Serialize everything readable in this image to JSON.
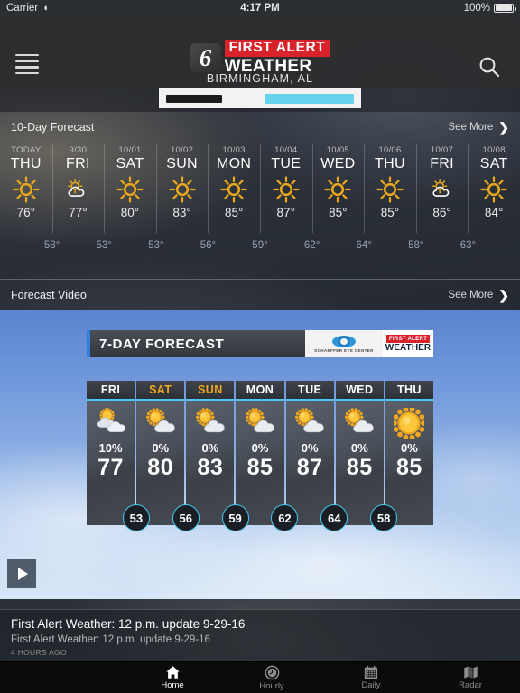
{
  "status_bar": {
    "carrier": "Carrier",
    "wifi_icon": "wifi-icon",
    "time": "4:17 PM",
    "battery_percent": "100%"
  },
  "header": {
    "menu_icon": "hamburger-menu-icon",
    "search_icon": "search-icon",
    "logo_number": "6",
    "logo_line1": "FIRST ALERT",
    "logo_line2": "WEATHER",
    "city": "BIRMINGHAM, AL"
  },
  "ten_day": {
    "title": "10-Day Forecast",
    "see_more": "See More",
    "chevron": "❯",
    "days": [
      {
        "date": "TODAY",
        "name": "THU",
        "icon": "sunny",
        "high": "76°"
      },
      {
        "date": "9/30",
        "name": "FRI",
        "icon": "partly-cloudy",
        "high": "77°"
      },
      {
        "date": "10/01",
        "name": "SAT",
        "icon": "sunny",
        "high": "80°"
      },
      {
        "date": "10/02",
        "name": "SUN",
        "icon": "sunny",
        "high": "83°"
      },
      {
        "date": "10/03",
        "name": "MON",
        "icon": "sunny",
        "high": "85°"
      },
      {
        "date": "10/04",
        "name": "TUE",
        "icon": "sunny",
        "high": "87°"
      },
      {
        "date": "10/05",
        "name": "WED",
        "icon": "sunny",
        "high": "85°"
      },
      {
        "date": "10/06",
        "name": "THU",
        "icon": "sunny",
        "high": "85°"
      },
      {
        "date": "10/07",
        "name": "FRI",
        "icon": "partly-cloudy",
        "high": "86°"
      },
      {
        "date": "10/08",
        "name": "SAT",
        "icon": "sunny",
        "high": "84°"
      }
    ],
    "lows": [
      "58°",
      "53°",
      "53°",
      "56°",
      "59°",
      "62°",
      "64°",
      "58°",
      "63°"
    ]
  },
  "forecast_video": {
    "title": "Forecast Video",
    "see_more": "See More",
    "chevron": "❯",
    "play_icon": "play-icon",
    "graphic": {
      "title": "7-DAY FORECAST",
      "sponsor_name": "SCHAEFFER EYE CENTER",
      "sponsor_icon": "eye-icon",
      "badge_line1": "FIRST ALERT",
      "badge_line2": "WEATHER",
      "columns": [
        {
          "day": "FRI",
          "weekend": false,
          "icon": "mostly-cloudy",
          "pop": "10%",
          "high": "77"
        },
        {
          "day": "SAT",
          "weekend": true,
          "icon": "partly-cloudy",
          "pop": "0%",
          "high": "80"
        },
        {
          "day": "SUN",
          "weekend": true,
          "icon": "partly-cloudy",
          "pop": "0%",
          "high": "83"
        },
        {
          "day": "MON",
          "weekend": false,
          "icon": "partly-cloudy",
          "pop": "0%",
          "high": "85"
        },
        {
          "day": "TUE",
          "weekend": false,
          "icon": "partly-cloudy",
          "pop": "0%",
          "high": "87"
        },
        {
          "day": "WED",
          "weekend": false,
          "icon": "partly-cloudy",
          "pop": "0%",
          "high": "85"
        },
        {
          "day": "THU",
          "weekend": false,
          "icon": "sunny",
          "pop": "0%",
          "high": "85"
        }
      ],
      "lows": [
        "53",
        "56",
        "59",
        "62",
        "64",
        "58"
      ]
    }
  },
  "article": {
    "headline": "First Alert Weather: 12 p.m. update 9-29-16",
    "summary": "First Alert Weather: 12 p.m. update 9-29-16",
    "timestamp": "4 HOURS AGO"
  },
  "tab_bar": {
    "tabs": [
      {
        "label": "Home",
        "icon": "home-icon",
        "active": true
      },
      {
        "label": "Hourly",
        "icon": "clock-icon",
        "active": false
      },
      {
        "label": "Daily",
        "icon": "calendar-icon",
        "active": false
      },
      {
        "label": "Radar",
        "icon": "map-icon",
        "active": false
      }
    ]
  },
  "colors": {
    "brand_red": "#d8232a",
    "sun_gold": "#e8a81c",
    "accent_cyan": "#49c9ef",
    "weekend_gold": "#f0a61e"
  }
}
